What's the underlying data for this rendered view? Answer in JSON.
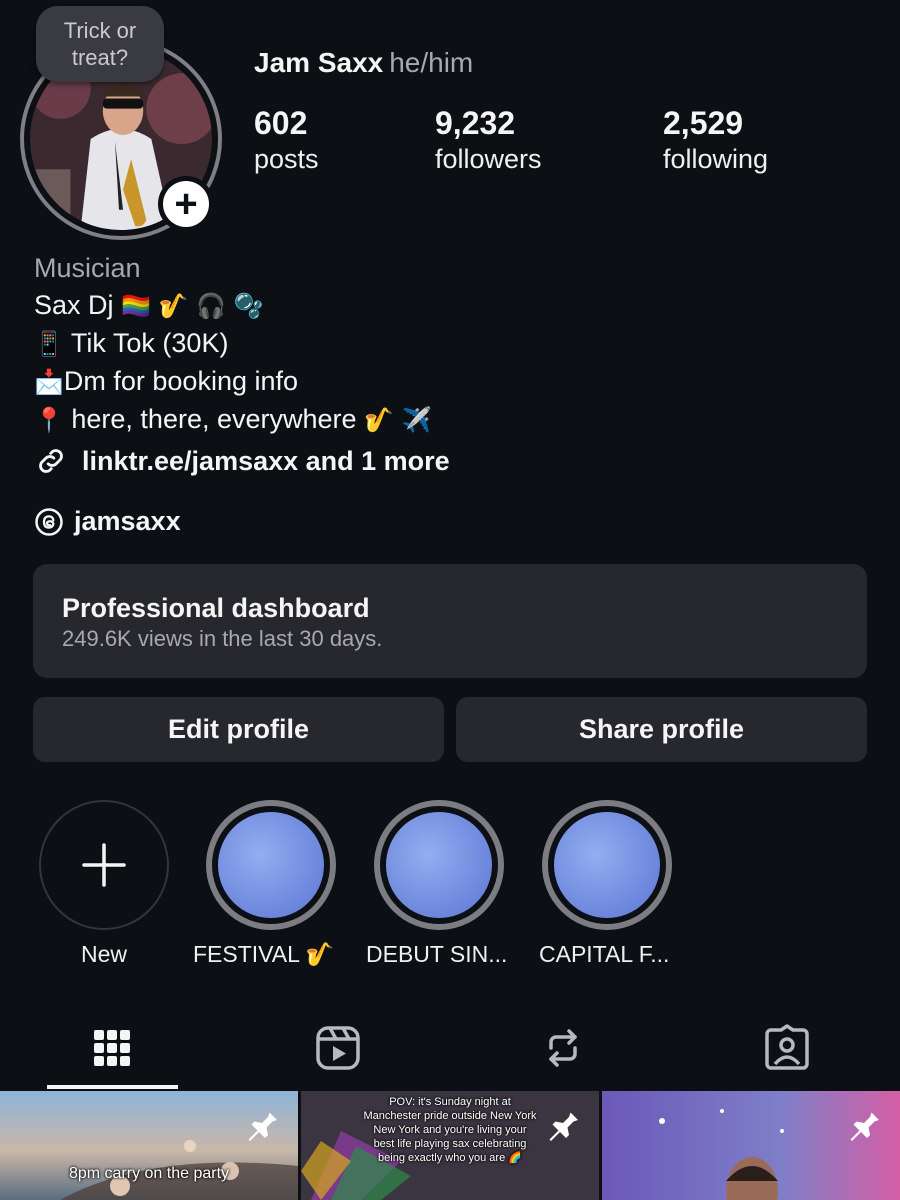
{
  "profile": {
    "username": "Jam Saxx",
    "pronouns": "he/him",
    "note": "Trick or treat?",
    "stats": {
      "posts": {
        "value": "602",
        "label": "posts"
      },
      "followers": {
        "value": "9,232",
        "label": "followers"
      },
      "following": {
        "value": "2,529",
        "label": "following"
      }
    }
  },
  "bio": {
    "category": "Musician",
    "line1": "Sax Dj",
    "line1_emoji": "🏳️‍🌈 🎷 🎧 🫧",
    "line2_emoji": "📱",
    "line2": " Tik Tok (30K)",
    "line3_emoji": "📩",
    "line3": "Dm for booking info",
    "line4_emoji": "📍",
    "line4": " here, there, everywhere ",
    "line4_end_emoji": "🎷 ✈️",
    "link": "linktr.ee/jamsaxx and 1 more",
    "threads": "jamsaxx"
  },
  "dashboard": {
    "title": "Professional dashboard",
    "subtitle": "249.6K views in the last 30 days."
  },
  "buttons": {
    "edit": "Edit profile",
    "share": "Share profile"
  },
  "highlights": [
    {
      "label": "New"
    },
    {
      "label": "FESTIVAL 🎷"
    },
    {
      "label": "DEBUT SIN..."
    },
    {
      "label": "CAPITAL F..."
    }
  ],
  "posts": [
    {
      "caption": "8pm carry on the party"
    },
    {
      "caption": "POV: it's Sunday night at Manchester pride outside New York New York and you're living your best life playing sax celebrating being exactly who you are 🌈"
    },
    {
      "caption": ""
    }
  ],
  "colors": {
    "background": "#0c0f14",
    "card": "#26282e",
    "muted": "#a8a8ad",
    "highlight": "#6b86db"
  }
}
